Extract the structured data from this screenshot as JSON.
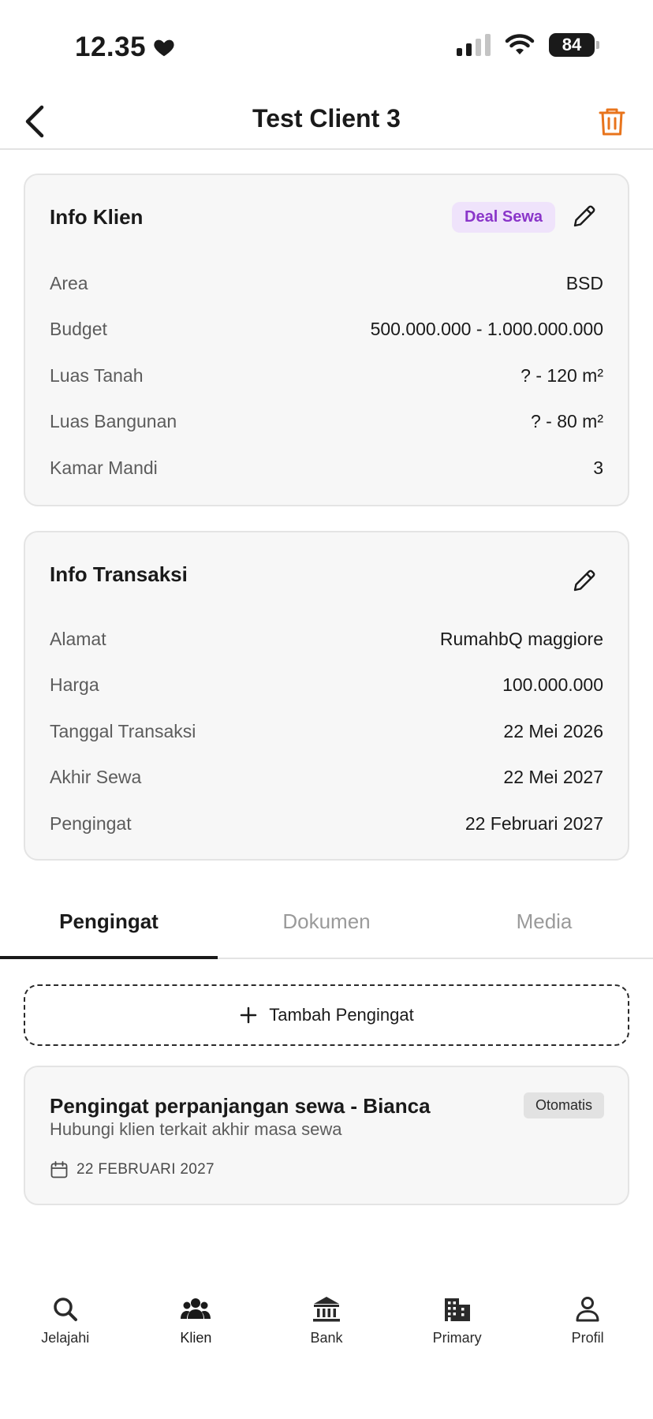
{
  "status_bar": {
    "time": "12.35",
    "battery": "84"
  },
  "header": {
    "title": "Test Client 3"
  },
  "info_klien": {
    "title": "Info Klien",
    "badge": "Deal Sewa",
    "rows": [
      {
        "label": "Area",
        "value": "BSD"
      },
      {
        "label": "Budget",
        "value": "500.000.000 - 1.000.000.000"
      },
      {
        "label": "Luas Tanah",
        "value": "? - 120 m²"
      },
      {
        "label": "Luas Bangunan",
        "value": "? - 80 m²"
      },
      {
        "label": "Kamar Mandi",
        "value": "3"
      }
    ]
  },
  "info_transaksi": {
    "title": "Info Transaksi",
    "rows": [
      {
        "label": "Alamat",
        "value": "RumahbQ maggiore"
      },
      {
        "label": "Harga",
        "value": "100.000.000"
      },
      {
        "label": "Tanggal Transaksi",
        "value": "22 Mei 2026"
      },
      {
        "label": "Akhir Sewa",
        "value": "22 Mei 2027"
      },
      {
        "label": "Pengingat",
        "value": "22 Februari 2027"
      }
    ]
  },
  "tabs": [
    {
      "label": "Pengingat",
      "active": true
    },
    {
      "label": "Dokumen",
      "active": false
    },
    {
      "label": "Media",
      "active": false
    }
  ],
  "add_reminder": {
    "label": "Tambah Pengingat"
  },
  "reminder": {
    "title": "Pengingat perpanjangan sewa - Bianca",
    "badge": "Otomatis",
    "subtitle": "Hubungi klien terkait akhir masa sewa",
    "date": "22 FEBRUARI 2027"
  },
  "bottom_nav": [
    {
      "label": "Jelajahi",
      "icon": "search-icon",
      "active": false
    },
    {
      "label": "Klien",
      "icon": "people-icon",
      "active": true
    },
    {
      "label": "Bank",
      "icon": "bank-icon",
      "active": false
    },
    {
      "label": "Primary",
      "icon": "building-icon",
      "active": false
    },
    {
      "label": "Profil",
      "icon": "user-icon",
      "active": false
    }
  ],
  "colors": {
    "accent": "#e8741c",
    "badge_purple": "#8a35c9",
    "badge_purple_bg": "#efe3fb"
  }
}
